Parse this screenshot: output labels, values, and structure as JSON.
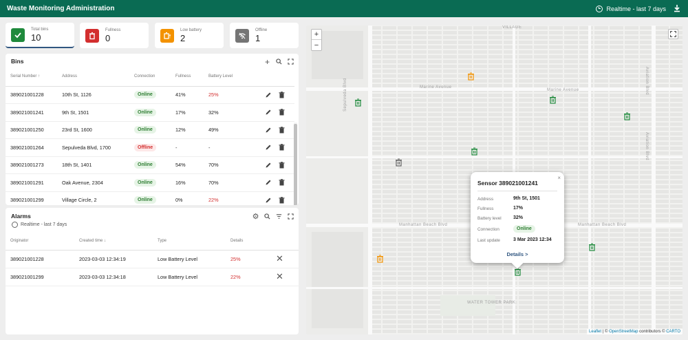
{
  "app": {
    "title": "Waste Monitoring Administration",
    "timewindow": "Realtime - last 7 days"
  },
  "kpis": [
    {
      "label": "Total bins",
      "value": "10",
      "color": "#1f8a3c",
      "icon": "check-icon"
    },
    {
      "label": "Fullness",
      "value": "0",
      "color": "#d32f2f",
      "icon": "trash-icon"
    },
    {
      "label": "Low battery",
      "value": "2",
      "color": "#f39200",
      "icon": "battery-low-icon"
    },
    {
      "label": "Offline",
      "value": "1",
      "color": "#757575",
      "icon": "wifi-off-icon"
    }
  ],
  "bins": {
    "title": "Bins",
    "columns": {
      "serial": "Serial Number",
      "address": "Address",
      "connection": "Connection",
      "fullness": "Fullness",
      "battery": "Battery Level"
    },
    "rows": [
      {
        "serial": "389021001228",
        "address": "10th St, 1126",
        "connection": "Online",
        "fullness": "41%",
        "battery": "25%",
        "battery_low": true
      },
      {
        "serial": "389021001241",
        "address": "9th St, 1501",
        "connection": "Online",
        "fullness": "17%",
        "battery": "32%",
        "battery_low": false
      },
      {
        "serial": "389021001250",
        "address": "23rd St, 1600",
        "connection": "Online",
        "fullness": "12%",
        "battery": "49%",
        "battery_low": false
      },
      {
        "serial": "389021001264",
        "address": "Sepulveda Blvd, 1700",
        "connection": "Offline",
        "fullness": "-",
        "battery": "-",
        "battery_low": false
      },
      {
        "serial": "389021001273",
        "address": "18th St, 1401",
        "connection": "Online",
        "fullness": "54%",
        "battery": "70%",
        "battery_low": false
      },
      {
        "serial": "389021001291",
        "address": "Oak Avenue, 2304",
        "connection": "Online",
        "fullness": "16%",
        "battery": "70%",
        "battery_low": false
      },
      {
        "serial": "389021001299",
        "address": "Village Circle, 2",
        "connection": "Online",
        "fullness": "0%",
        "battery": "22%",
        "battery_low": true
      }
    ]
  },
  "alarms": {
    "title": "Alarms",
    "timewindow": "Realtime - last 7 days",
    "columns": {
      "originator": "Originator",
      "created": "Created time",
      "type": "Type",
      "details": "Details"
    },
    "rows": [
      {
        "originator": "389021001228",
        "created": "2023-03-03 12:34:19",
        "type": "Low Battery Level",
        "details": "25%"
      },
      {
        "originator": "389021001299",
        "created": "2023-03-03 12:34:18",
        "type": "Low Battery Level",
        "details": "22%"
      }
    ]
  },
  "map": {
    "streets": {
      "village": "VILLAGE",
      "marine": "Marine Avenue",
      "manhattan": "Manhattan Beach Blvd",
      "sepulveda": "Sepulveda Blvd",
      "aviation": "Aviation Blvd",
      "park": "WATER TOWER PARK"
    },
    "attribution": {
      "leaflet": "Leaflet",
      "sep": "| ©",
      "osm": "OpenStreetMap",
      "contrib": "contributors ©",
      "carto": "CARTO"
    },
    "popup": {
      "title": "Sensor 389021001241",
      "labels": {
        "address": "Address",
        "fullness": "Fullness",
        "battery": "Battery level",
        "connection": "Connection",
        "update": "Last update"
      },
      "values": {
        "address": "9th St, 1501",
        "fullness": "17%",
        "battery": "32%",
        "connection": "Online",
        "update": "3 Mar 2023 12:34"
      },
      "details": "Details >"
    }
  }
}
